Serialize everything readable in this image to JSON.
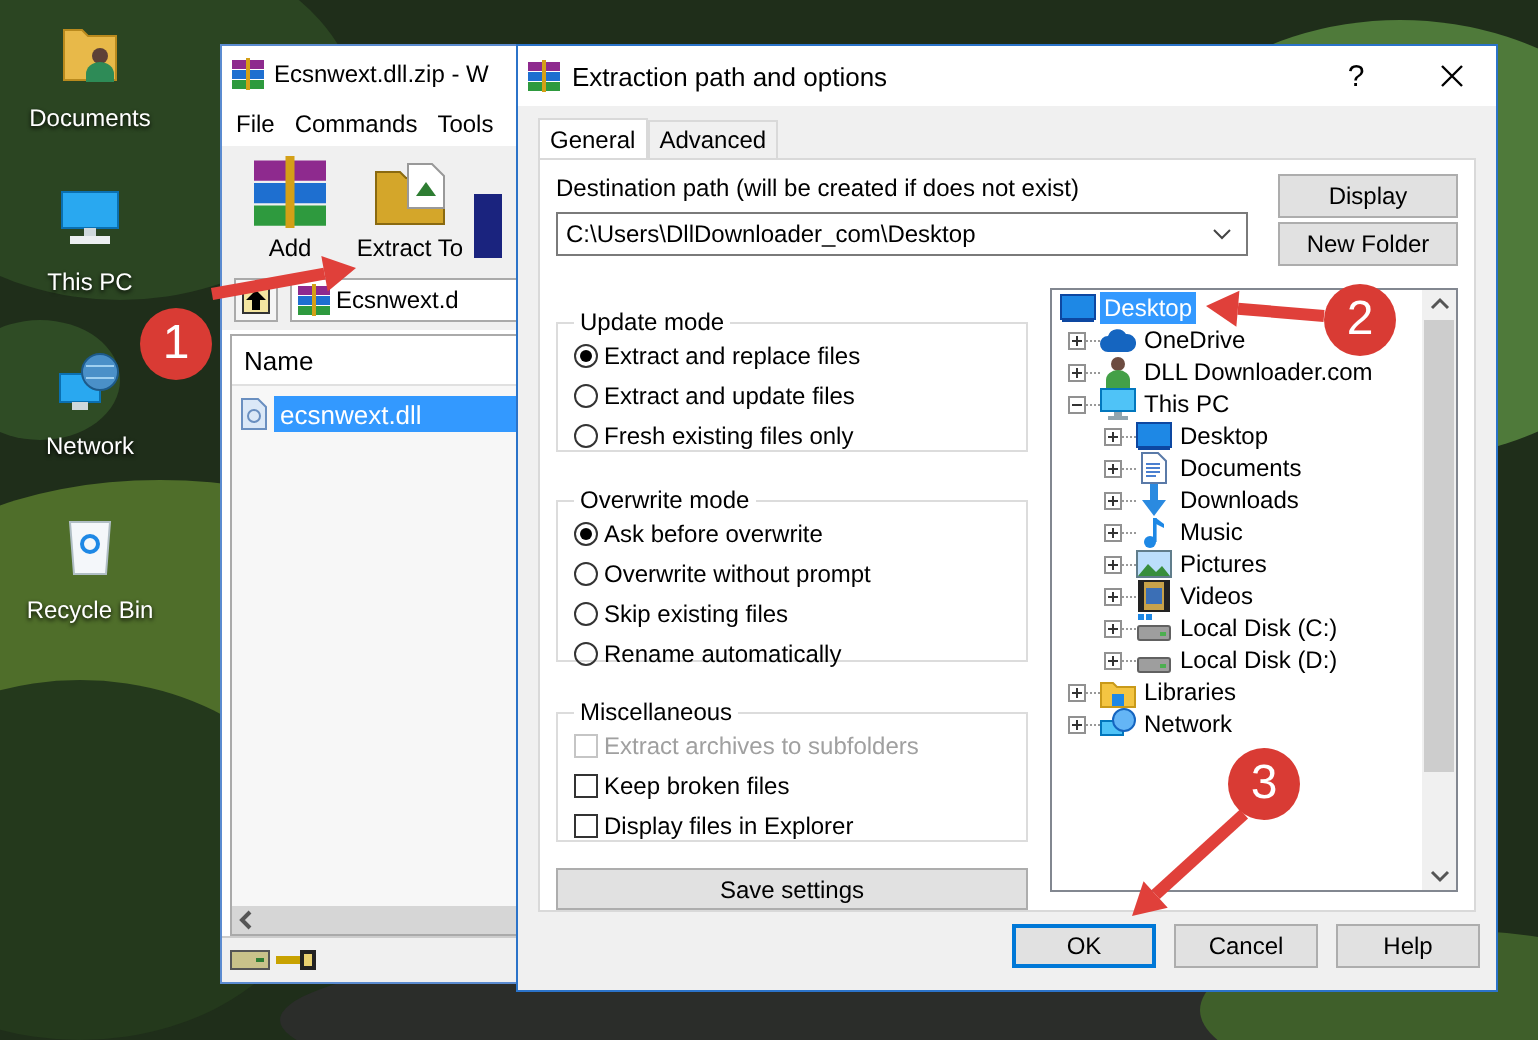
{
  "desktop_icons": [
    {
      "label": "Documents",
      "kind": "documents"
    },
    {
      "label": "This PC",
      "kind": "pc"
    },
    {
      "label": "Network",
      "kind": "network"
    },
    {
      "label": "Recycle Bin",
      "kind": "recycle_bin"
    }
  ],
  "archive_window": {
    "title": "Ecsnwext.dll.zip - W",
    "menu": [
      "File",
      "Commands",
      "Tools"
    ],
    "toolbar": [
      {
        "kind": "add",
        "label": "Add"
      },
      {
        "kind": "extract",
        "label": "Extract To"
      },
      {
        "kind": "book"
      }
    ],
    "address": "Ecsnwext.d",
    "columns": [
      "Name"
    ],
    "files": [
      {
        "name": "ecsnwext.dll",
        "selected": true
      }
    ]
  },
  "dialog": {
    "title": "Extraction path and options",
    "help": "?",
    "tabs": [
      {
        "label": "General",
        "selected": true
      },
      {
        "label": "Advanced",
        "selected": false
      }
    ],
    "path_label": "Destination path (will be created if does not exist)",
    "path": "C:\\Users\\DllDownloader_com\\Desktop",
    "side_buttons": [
      "Display",
      "New Folder"
    ],
    "groups": [
      {
        "title": "Update mode",
        "options": [
          {
            "kind": "radio",
            "label": "Extract and replace files",
            "selected": true
          },
          {
            "kind": "radio",
            "label": "Extract and update files",
            "selected": false
          },
          {
            "kind": "radio",
            "label": "Fresh existing files only",
            "selected": false
          }
        ]
      },
      {
        "title": "Overwrite mode",
        "options": [
          {
            "kind": "radio",
            "label": "Ask before overwrite",
            "selected": true
          },
          {
            "kind": "radio",
            "label": "Overwrite without prompt",
            "selected": false
          },
          {
            "kind": "radio",
            "label": "Skip existing files",
            "selected": false
          },
          {
            "kind": "radio",
            "label": "Rename automatically",
            "selected": false
          }
        ]
      },
      {
        "title": "Miscellaneous",
        "options": [
          {
            "kind": "checkbox",
            "label": "Extract archives to subfolders",
            "checked": false,
            "disabled": true
          },
          {
            "kind": "checkbox",
            "label": "Keep broken files",
            "checked": false,
            "disabled": false
          },
          {
            "kind": "checkbox",
            "label": "Display files in Explorer",
            "checked": false,
            "disabled": false
          }
        ]
      }
    ],
    "save_button": "Save settings",
    "tree": [
      {
        "label": "Desktop",
        "kind": "desktop",
        "selected": true,
        "children": [
          {
            "label": "OneDrive",
            "kind": "cloud",
            "selected": false,
            "expanded": false
          },
          {
            "label": "DLL Downloader.com",
            "kind": "user",
            "selected": false,
            "expanded": false
          },
          {
            "label": "This PC",
            "kind": "pc",
            "selected": false,
            "expanded": true,
            "children": [
              {
                "label": "Desktop",
                "kind": "desktop",
                "selected": false,
                "expanded": false
              },
              {
                "label": "Documents",
                "kind": "documents",
                "selected": false,
                "expanded": false
              },
              {
                "label": "Downloads",
                "kind": "downloads",
                "selected": false,
                "expanded": false
              },
              {
                "label": "Music",
                "kind": "music",
                "selected": false,
                "expanded": false
              },
              {
                "label": "Pictures",
                "kind": "pictures",
                "selected": false,
                "expanded": false
              },
              {
                "label": "Videos",
                "kind": "videos",
                "selected": false,
                "expanded": false
              },
              {
                "label": "Local Disk (C:)",
                "kind": "system_disk",
                "selected": false,
                "expanded": false
              },
              {
                "label": "Local Disk (D:)",
                "kind": "disk",
                "selected": false,
                "expanded": false
              }
            ]
          },
          {
            "label": "Libraries",
            "kind": "library",
            "selected": false,
            "expanded": false
          },
          {
            "label": "Network",
            "kind": "network",
            "selected": false,
            "expanded": false
          }
        ]
      }
    ],
    "buttons": [
      {
        "label": "OK",
        "default": true
      },
      {
        "label": "Cancel",
        "default": false
      },
      {
        "label": "Help",
        "default": false
      }
    ]
  },
  "callouts": [
    {
      "number": "1"
    },
    {
      "number": "2"
    },
    {
      "number": "3"
    }
  ]
}
